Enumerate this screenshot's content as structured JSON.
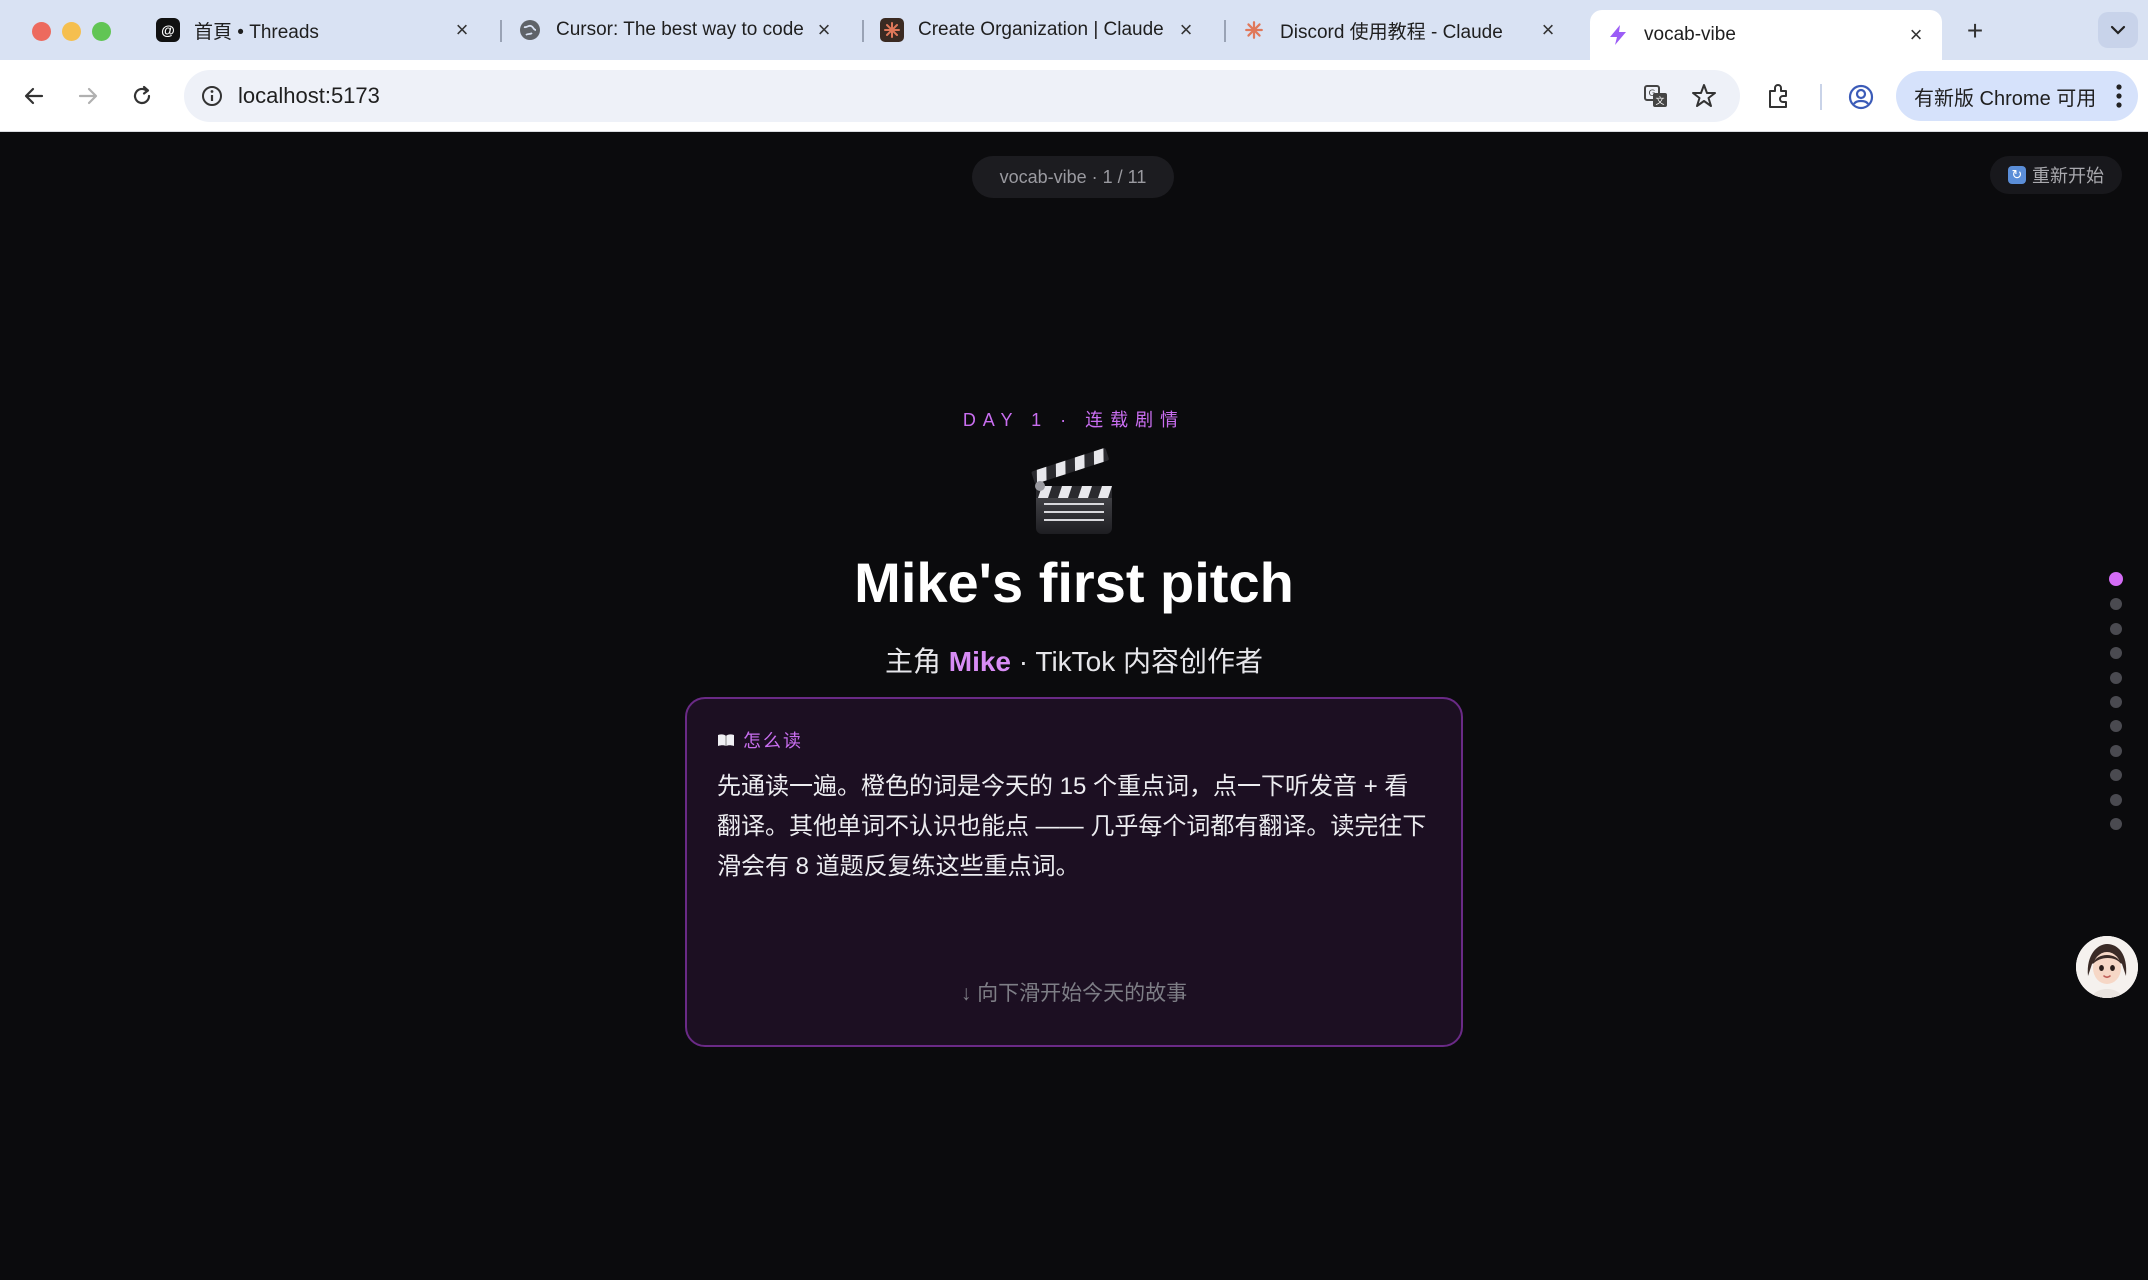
{
  "browser": {
    "tabs": [
      {
        "title": "首頁 • Threads",
        "icon": "threads-icon",
        "active": false
      },
      {
        "title": "Cursor: The best way to code",
        "icon": "globe-icon",
        "active": false
      },
      {
        "title": "Create Organization | Claude",
        "icon": "claude-icon",
        "active": false
      },
      {
        "title": "Discord 使用教程 - Claude",
        "icon": "claude-icon",
        "active": false
      },
      {
        "title": "vocab-vibe",
        "icon": "vite-icon",
        "active": true
      }
    ],
    "url": "localhost:5173",
    "update_label": "有新版 Chrome 可用"
  },
  "app": {
    "progress_label": "vocab-vibe · 1 / 11",
    "restart_label": "重新开始",
    "eyebrow": "DAY 1 · 连载剧情",
    "hero_emoji": "clapperboard-icon",
    "title": "Mike's first pitch",
    "subtitle_prefix": "主角",
    "subtitle_name": "Mike",
    "subtitle_suffix": "· TikTok 内容创作者",
    "howto_heading": "怎么读",
    "howto_body": "先通读一遍。橙色的词是今天的 15 个重点词，点一下听发音 + 看翻译。其他单词不认识也能点 —— 几乎每个词都有翻译。读完往下滑会有 8 道题反复练这些重点词。",
    "scroll_hint": "↓ 向下滑开始今天的故事",
    "section_count": 11,
    "current_section": 1
  },
  "colors": {
    "accent": "#c96ef0",
    "background": "#0b0b0d",
    "card_border": "#6a2a86"
  }
}
